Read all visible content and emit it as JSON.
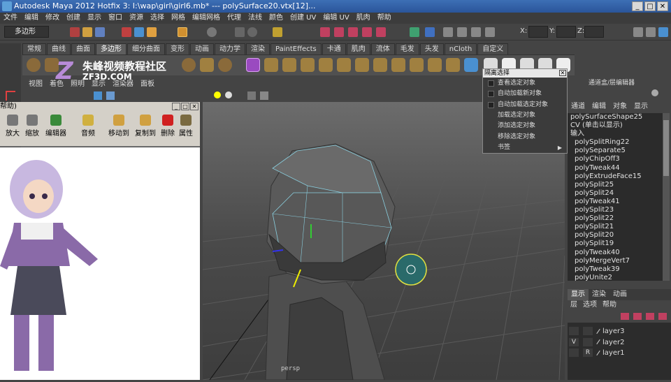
{
  "window": {
    "title": "Autodesk Maya 2012 Hotfix 3: I:\\wap\\girl\\girl6.mb* --- polySurface20.vtx[12]...",
    "min": "_",
    "max": "□",
    "close": "✕"
  },
  "menubar": [
    "文件",
    "编辑",
    "修改",
    "创建",
    "显示",
    "窗口",
    "资源",
    "选择",
    "网格",
    "编辑网格",
    "代理",
    "法线",
    "颜色",
    "创建 UV",
    "编辑 UV",
    "肌肉",
    "帮助"
  ],
  "statusline": {
    "mode": "多边形",
    "x_label": "X:",
    "y_label": "Y:",
    "z_label": "Z:"
  },
  "shelf_tabs": [
    "常规",
    "曲线",
    "曲面",
    "多边形",
    "细分曲面",
    "变形",
    "动画",
    "动力学",
    "渲染",
    "PaintEffects",
    "卡通",
    "肌肉",
    "流体",
    "毛发",
    "头发",
    "nCloth",
    "自定义"
  ],
  "shelf_active": "多边形",
  "watermark": {
    "logo": "Z",
    "text": "朱峰视频教程社区",
    "url": "ZF3D.COM"
  },
  "viewport": {
    "menu": [
      "视图",
      "着色",
      "照明",
      "显示",
      "渲染器",
      "面板"
    ],
    "label": "persp"
  },
  "left_panel": {
    "title": "帮助)",
    "toolbar": [
      "放大",
      "缩放",
      "编辑器",
      "音频",
      "移动到",
      "复制到",
      "删除",
      "属性"
    ]
  },
  "popup": {
    "title": "隔离选择",
    "items": [
      "查看选定对象",
      "自动加载新对象",
      "自动加载选定对象",
      "加载选定对象",
      "添加选定对象",
      "移除选定对象",
      "书签"
    ]
  },
  "right_panel": {
    "title": "通道盒/层编辑器",
    "tabs": [
      "通道",
      "编辑",
      "对象",
      "显示"
    ],
    "list": [
      "polySurfaceShape25",
      "CV (单击以显示)",
      "输入",
      "polySplitRing22",
      "polySeparate5",
      "polyChipOff3",
      "polyTweak44",
      "polyExtrudeFace15",
      "polySplit25",
      "polySplit24",
      "polyTweak41",
      "polySplit23",
      "polySplit22",
      "polySplit21",
      "polySplit20",
      "polySplit19",
      "polyTweak40",
      "polyMergeVert7",
      "polyTweak39",
      "polyUnite2"
    ]
  },
  "layer_editor": {
    "tabs": [
      "显示",
      "渲染",
      "动画"
    ],
    "menu": [
      "层",
      "选项",
      "帮助"
    ],
    "layers": [
      {
        "name": "layer3",
        "v": "",
        "r": ""
      },
      {
        "name": "layer2",
        "v": "V",
        "r": ""
      },
      {
        "name": "layer1",
        "v": "",
        "r": "R"
      }
    ]
  },
  "colors": {
    "title_bar": "#2a559a",
    "viewport_top": "#6c6c6c",
    "selection": "#1ec8e0"
  }
}
